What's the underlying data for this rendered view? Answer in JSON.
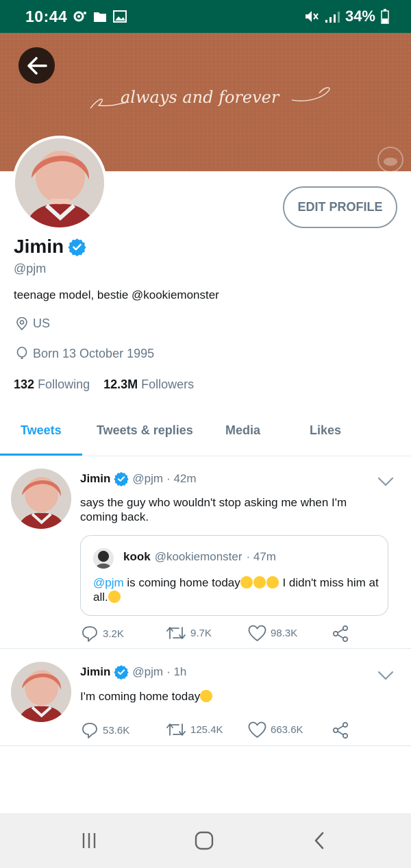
{
  "status_bar": {
    "time": "10:44",
    "battery": "34%",
    "icons": [
      "notification-dot-icon",
      "folder-icon",
      "image-icon",
      "mute-icon",
      "signal-icon",
      "battery-icon"
    ]
  },
  "header": {
    "banner_script": "always and forever",
    "back_icon": "arrow-left-icon"
  },
  "profile": {
    "edit_button": "EDIT PROFILE",
    "name": "Jimin",
    "verified_icon": "verified-badge-icon",
    "handle": "@pjm",
    "bio": "teenage model, bestie @kookiemonster",
    "location": "US",
    "birthday": "Born 13 October 1995",
    "following_count": "132",
    "following_label": "Following",
    "followers_count": "12.3M",
    "followers_label": "Followers"
  },
  "tabs": [
    {
      "label": "Tweets",
      "active": true
    },
    {
      "label": "Tweets & replies",
      "active": false
    },
    {
      "label": "Media",
      "active": false
    },
    {
      "label": "Likes",
      "active": false
    }
  ],
  "tweets": [
    {
      "name": "Jimin",
      "handle": "@pjm",
      "time": "· 42m",
      "text": "says the guy who wouldn't stop asking me when I'm coming back.",
      "quote": {
        "name": "kook",
        "handle": "@kookiemonster",
        "time": "· 47m",
        "mention": "@pjm",
        "text_a": " is coming home today",
        "text_b": " I didn't miss him at all."
      },
      "replies": "3.2K",
      "retweets": "9.7K",
      "likes": "98.3K"
    },
    {
      "name": "Jimin",
      "handle": "@pjm",
      "time": "· 1h",
      "text": "I'm coming home today",
      "replies": "53.6K",
      "retweets": "125.4K",
      "likes": "663.6K"
    }
  ],
  "colors": {
    "accent": "#1da1f2",
    "banner": "#b06848",
    "status_bar": "#005f4b",
    "muted_text": "#657786"
  }
}
